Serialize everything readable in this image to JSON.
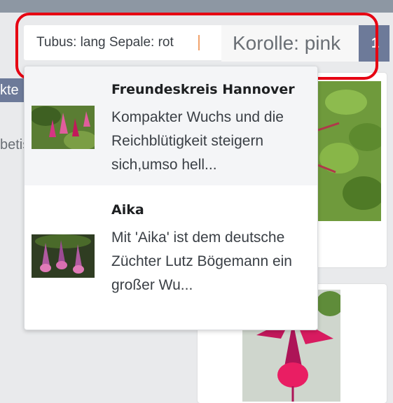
{
  "search": {
    "tags_text": "Tubus: lang Sepale: rot",
    "chip_text": "Korolle: pink",
    "page_button": "1"
  },
  "sidebar": {
    "tab_fragment": "kte",
    "text_fragment": "betis"
  },
  "suggestions": [
    {
      "title": "Freundeskreis Hannover",
      "description": "Kompakter Wuchs und die Reichblütigkeit steigern sich,umso hell..."
    },
    {
      "title": "Aika",
      "description": "Mit 'Aika' ist dem deutsche Züchter Lutz Bögemann ein großer Wu..."
    }
  ],
  "colors": {
    "accent": "#6d7a99",
    "focus_ring": "#e60012",
    "fuchsia": "#c2185b"
  }
}
